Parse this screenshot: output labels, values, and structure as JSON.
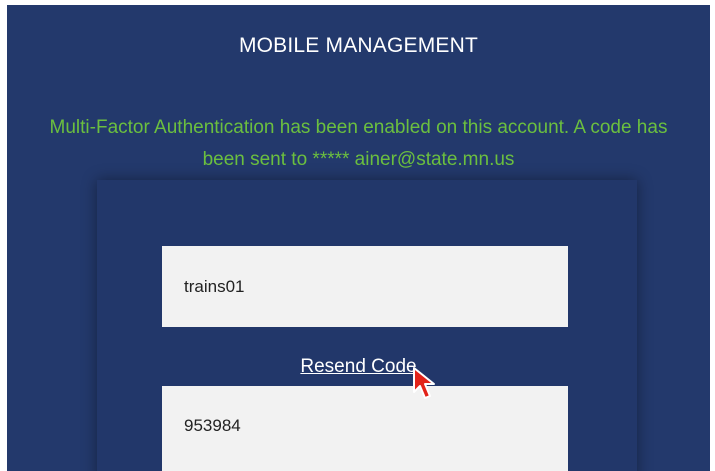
{
  "header": {
    "title": "MOBILE MANAGEMENT"
  },
  "mfa": {
    "message": "Multi-Factor Authentication has been enabled on this account. A code has been sent to ***** ainer@state.mn.us"
  },
  "form": {
    "username_value": "trains01",
    "resend_label": "Resend Code",
    "code_value": "953984"
  },
  "colors": {
    "background": "#23396c",
    "message_text": "#6bbf3f",
    "field_background": "#f2f2f2"
  }
}
